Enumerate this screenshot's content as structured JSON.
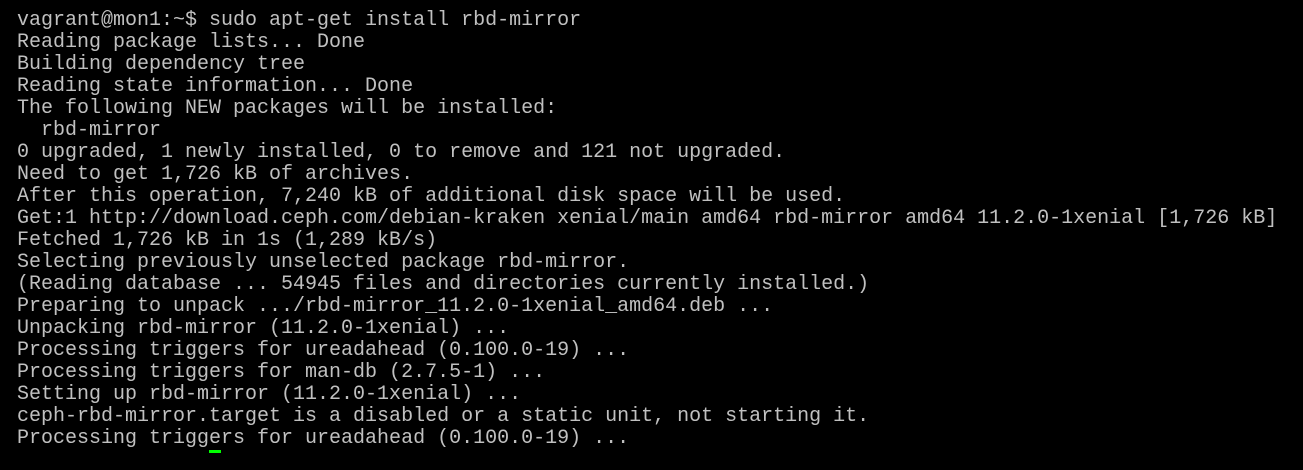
{
  "terminal": {
    "colors": {
      "background": "#000000",
      "text": "#c0c0c0",
      "cursor": "#00ff00"
    },
    "lines": [
      "vagrant@mon1:~$ sudo apt-get install rbd-mirror",
      "Reading package lists... Done",
      "Building dependency tree",
      "Reading state information... Done",
      "The following NEW packages will be installed:",
      "  rbd-mirror",
      "0 upgraded, 1 newly installed, 0 to remove and 121 not upgraded.",
      "Need to get 1,726 kB of archives.",
      "After this operation, 7,240 kB of additional disk space will be used.",
      "Get:1 http://download.ceph.com/debian-kraken xenial/main amd64 rbd-mirror amd64 11.2.0-1xenial [1,726 kB]",
      "Fetched 1,726 kB in 1s (1,289 kB/s)",
      "Selecting previously unselected package rbd-mirror.",
      "(Reading database ... 54945 files and directories currently installed.)",
      "Preparing to unpack .../rbd-mirror_11.2.0-1xenial_amd64.deb ...",
      "Unpacking rbd-mirror (11.2.0-1xenial) ...",
      "Processing triggers for ureadahead (0.100.0-19) ...",
      "Processing triggers for man-db (2.7.5-1) ...",
      "Setting up rbd-mirror (11.2.0-1xenial) ...",
      "ceph-rbd-mirror.target is a disabled or a static unit, not starting it.",
      "Processing triggers for ureadahead (0.100.0-19) ..."
    ]
  }
}
